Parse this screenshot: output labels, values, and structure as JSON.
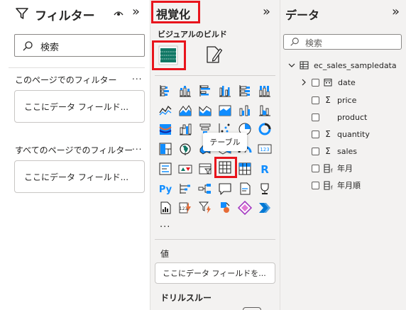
{
  "filters": {
    "title": "フィルター",
    "search_placeholder": "検索",
    "page_section": "このページでのフィルター",
    "page_well": "ここにデータ フィールド...",
    "all_pages_section": "すべてのページでのフィルター",
    "all_pages_well": "ここにデータ フィールド...",
    "more": "...",
    "collapse": "»"
  },
  "visualizations": {
    "title": "視覚化",
    "collapse": "»",
    "build_label": "ビジュアルのビルド",
    "tooltip": "テーブル",
    "more_visuals": "...",
    "values_label": "値",
    "values_well": "ここにデータ フィールドを...",
    "drillthrough_label": "ドリルスルー",
    "icons": [
      [
        "stacked-bar-chart-icon",
        "stacked-column-chart-icon",
        "clustered-bar-chart-icon",
        "clustered-column-chart-icon",
        "100-stacked-bar-chart-icon",
        "100-stacked-column-chart-icon"
      ],
      [
        "line-chart-icon",
        "area-chart-icon",
        "stacked-area-chart-icon",
        "line-and-stacked-column-icon",
        "line-and-clustered-column-icon",
        "ribbon-chart-icon"
      ],
      [
        "waterfall-chart-icon",
        "funnel-chart-icon",
        "scatter-chart-icon",
        "pie-chart-icon",
        "donut-chart-icon",
        "treemap-icon"
      ],
      [
        "treemap-icon",
        "map-icon",
        "filled-map-icon",
        "azure-map-icon",
        "gauge-icon",
        "card-icon"
      ],
      [
        "kpi-icon",
        "multi-row-card-icon",
        "slicer-icon",
        "table-icon",
        "matrix-icon",
        "r-script-visual-icon"
      ],
      [
        "python-visual-icon",
        "key-influencers-icon",
        "decomposition-tree-icon",
        "qa-icon",
        "smart-narrative-icon",
        "goals-icon"
      ],
      [
        "paginated-report-icon",
        "power-apps-icon",
        "power-automate-icon",
        "arcgis-map-icon",
        "shape-map-icon",
        "get-more-visuals-icon"
      ]
    ]
  },
  "data": {
    "title": "データ",
    "collapse": "»",
    "search_placeholder": "検索",
    "table_name": "ec_sales_sampledata",
    "fields": [
      {
        "name": "date",
        "type": "date",
        "expandable": true
      },
      {
        "name": "price",
        "type": "sum"
      },
      {
        "name": "product",
        "type": "text"
      },
      {
        "name": "quantity",
        "type": "sum"
      },
      {
        "name": "sales",
        "type": "sum"
      },
      {
        "name": "年月",
        "type": "calc"
      },
      {
        "name": "年月順",
        "type": "calc"
      }
    ]
  },
  "colors": {
    "highlight_red": "#e8141c",
    "pane_bg": "#f3f2f1",
    "accent_green": "#117865",
    "chart_blue": "#118dff",
    "chart_navy": "#12239e",
    "chart_orange": "#e66c37"
  }
}
